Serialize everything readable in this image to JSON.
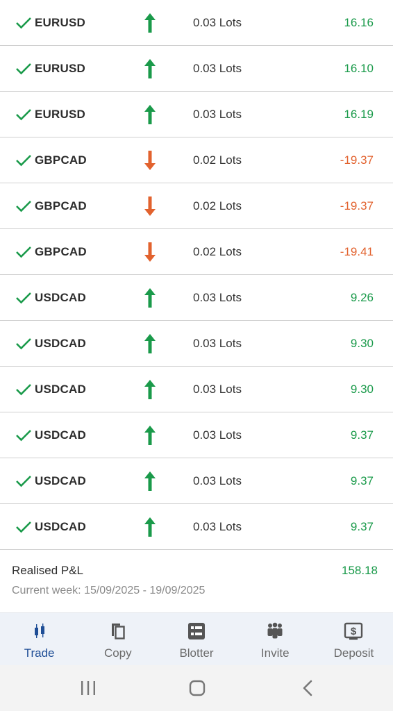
{
  "trades": [
    {
      "symbol": "EURUSD",
      "direction": "up",
      "lots": "0.03 Lots",
      "pnl": "16.16"
    },
    {
      "symbol": "EURUSD",
      "direction": "up",
      "lots": "0.03 Lots",
      "pnl": "16.10"
    },
    {
      "symbol": "EURUSD",
      "direction": "up",
      "lots": "0.03 Lots",
      "pnl": "16.19"
    },
    {
      "symbol": "GBPCAD",
      "direction": "down",
      "lots": "0.02 Lots",
      "pnl": "-19.37"
    },
    {
      "symbol": "GBPCAD",
      "direction": "down",
      "lots": "0.02 Lots",
      "pnl": "-19.37"
    },
    {
      "symbol": "GBPCAD",
      "direction": "down",
      "lots": "0.02 Lots",
      "pnl": "-19.41"
    },
    {
      "symbol": "USDCAD",
      "direction": "up",
      "lots": "0.03 Lots",
      "pnl": "9.26"
    },
    {
      "symbol": "USDCAD",
      "direction": "up",
      "lots": "0.03 Lots",
      "pnl": "9.30"
    },
    {
      "symbol": "USDCAD",
      "direction": "up",
      "lots": "0.03 Lots",
      "pnl": "9.30"
    },
    {
      "symbol": "USDCAD",
      "direction": "up",
      "lots": "0.03 Lots",
      "pnl": "9.37"
    },
    {
      "symbol": "USDCAD",
      "direction": "up",
      "lots": "0.03 Lots",
      "pnl": "9.37"
    },
    {
      "symbol": "USDCAD",
      "direction": "up",
      "lots": "0.03 Lots",
      "pnl": "9.37"
    }
  ],
  "summary": {
    "label": "Realised P&L",
    "value": "158.18",
    "week": "Current week: 15/09/2025 - 19/09/2025"
  },
  "tabs": [
    {
      "label": "Trade",
      "icon": "candlestick-icon",
      "active": true
    },
    {
      "label": "Copy",
      "icon": "copy-icon",
      "active": false
    },
    {
      "label": "Blotter",
      "icon": "blotter-icon",
      "active": false
    },
    {
      "label": "Invite",
      "icon": "people-icon",
      "active": false
    },
    {
      "label": "Deposit",
      "icon": "deposit-icon",
      "active": false
    }
  ],
  "system_nav": [
    "recent-apps-icon",
    "home-icon",
    "back-icon"
  ],
  "colors": {
    "positive": "#1a9a4a",
    "negative": "#e2622e",
    "accent": "#1f4e96",
    "icon_grey": "#555555"
  }
}
